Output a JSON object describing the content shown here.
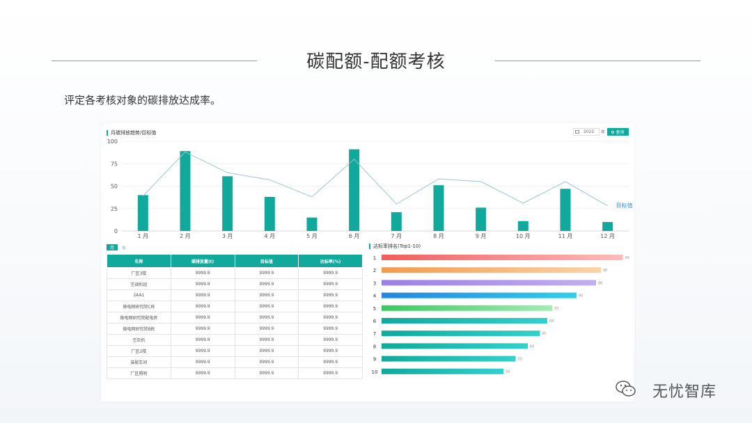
{
  "slide": {
    "title": "碳配额-配额考核",
    "subtitle": "评定各考核对象的碳排放达成率。"
  },
  "top_panel": {
    "title": "月碳排放趋势/目标值",
    "year": "2022",
    "year_unit": "年",
    "query_label": "查询"
  },
  "colors": {
    "accent": "#10a99b",
    "target_line": "#9fc3cf",
    "target_label": "#3a8cc9"
  },
  "chart_data": [
    {
      "type": "bar",
      "title": "月碳排放趋势/目标值",
      "categories": [
        "1 月",
        "2 月",
        "3 月",
        "4 月",
        "5 月",
        "6 月",
        "7 月",
        "8 月",
        "9 月",
        "10 月",
        "11 月",
        "12 月"
      ],
      "yticks": [
        0,
        25,
        50,
        75,
        100
      ],
      "ylim": [
        0,
        100
      ],
      "grid": true,
      "series": [
        {
          "values": [
            40,
            89,
            61,
            38,
            15,
            91,
            21,
            51,
            26,
            11,
            47,
            10
          ],
          "color": "#10a99b"
        },
        {
          "name": "目标值",
          "type": "line",
          "values": [
            39,
            88,
            65,
            57,
            38,
            80,
            30,
            58,
            55,
            31,
            55,
            28
          ],
          "color": "#9fc3cf"
        }
      ]
    },
    {
      "type": "bar",
      "orientation": "horizontal",
      "title": "达标率排名(Top1-10)",
      "categories": [
        "1",
        "2",
        "3",
        "4",
        "5",
        "6",
        "7",
        "8",
        "9",
        "10"
      ],
      "values": [
        99,
        90,
        88,
        80,
        70,
        68,
        65,
        60,
        55,
        50
      ],
      "xlim": [
        0,
        100
      ],
      "colors": [
        [
          "#f25c5c",
          "#fdbcbc"
        ],
        [
          "#f39b4a",
          "#fbd3a8"
        ],
        [
          "#9b7ee8",
          "#c2aef2"
        ],
        [
          "#2386e0",
          "#2fd0e8"
        ],
        [
          "#3cc85e",
          "#a3ecb3"
        ],
        [
          "#10a99b",
          "#34d0cc"
        ],
        [
          "#10a99b",
          "#34d0cc"
        ],
        [
          "#10a99b",
          "#34d0cc"
        ],
        [
          "#10a99b",
          "#34d0cc"
        ],
        [
          "#10a99b",
          "#34d0cc"
        ]
      ]
    }
  ],
  "tabs": {
    "month": "月",
    "year": "年"
  },
  "table": {
    "headers": [
      "名称",
      "碳排放量(t)",
      "目标值",
      "达标率(%)"
    ],
    "rows": [
      [
        "厂区3楼",
        "9999.9",
        "9999.9",
        "9999.9"
      ],
      [
        "空调机组",
        "9999.9",
        "9999.9",
        "9999.9"
      ],
      [
        "2AA1",
        "9999.9",
        "9999.9",
        "9999.9"
      ],
      [
        "微电网研究院C栋",
        "9999.9",
        "9999.9",
        "9999.9"
      ],
      [
        "微电网研究院配电房",
        "9999.9",
        "9999.9",
        "9999.9"
      ],
      [
        "微电网研究院B栋",
        "9999.9",
        "9999.9",
        "9999.9"
      ],
      [
        "空压机",
        "9999.9",
        "9999.9",
        "9999.9"
      ],
      [
        "厂区2楼",
        "9999.9",
        "9999.9",
        "9999.9"
      ],
      [
        "装配车间",
        "9999.9",
        "9999.9",
        "9999.9"
      ],
      [
        "厂区照明",
        "9999.9",
        "9999.9",
        "9999.9"
      ]
    ]
  },
  "watermark": {
    "text": "无忧智库",
    "icon": "wechat-icon"
  }
}
